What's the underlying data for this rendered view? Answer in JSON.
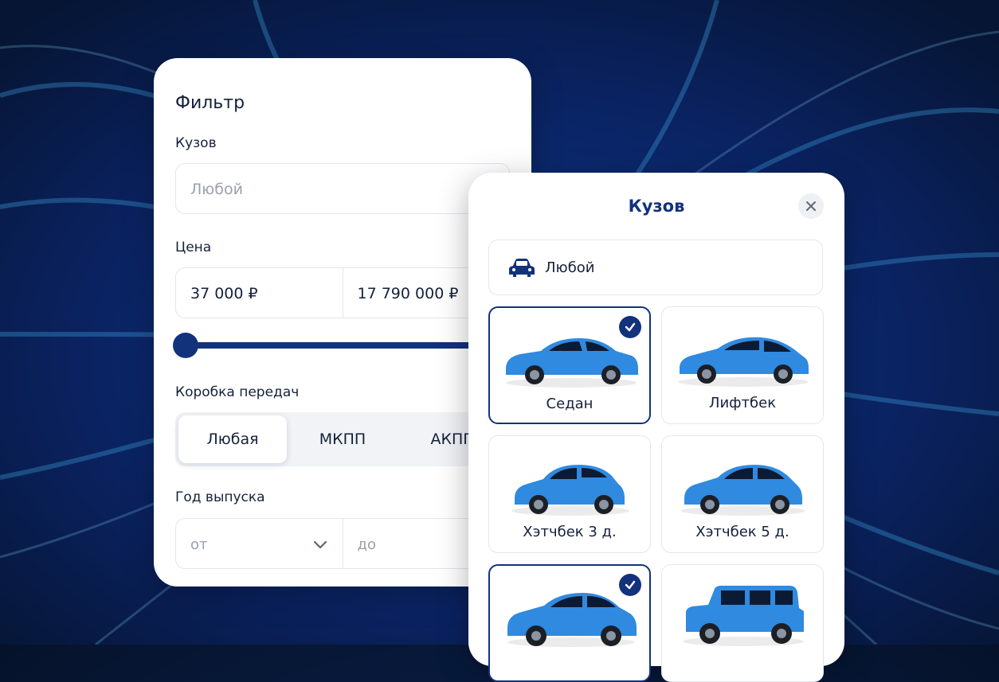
{
  "filter": {
    "title": "Фильтр",
    "body_label": "Кузов",
    "body_placeholder": "Любой",
    "price_label": "Цена",
    "price_from": "37 000 ₽",
    "price_to": "17 790 000 ₽",
    "gearbox_label": "Коробка передач",
    "gearbox_options": [
      "Любая",
      "МКПП",
      "АКПП"
    ],
    "gearbox_selected": "Любая",
    "year_label": "Год выпуска",
    "year_from_placeholder": "от",
    "year_to_placeholder": "до"
  },
  "modal": {
    "title": "Кузов",
    "any_option": "Любой",
    "tiles": [
      {
        "label": "Седан",
        "selected": true
      },
      {
        "label": "Лифтбек",
        "selected": false
      },
      {
        "label": "Хэтчбек 3 д.",
        "selected": false
      },
      {
        "label": "Хэтчбек 5 д.",
        "selected": false
      },
      {
        "label": "",
        "selected": true
      },
      {
        "label": "",
        "selected": false
      }
    ]
  },
  "colors": {
    "accent": "#13327c",
    "car_blue": "#2f8ae0"
  }
}
